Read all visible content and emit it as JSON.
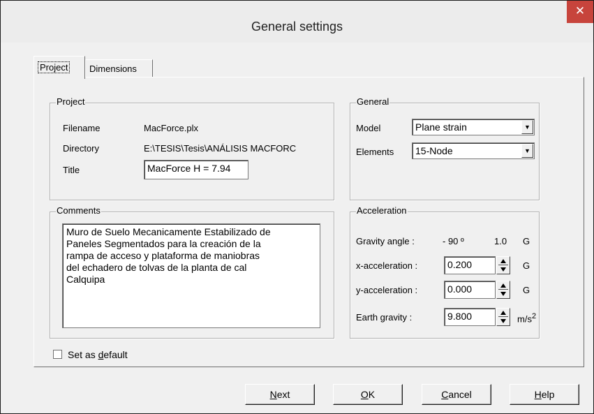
{
  "window": {
    "title": "General settings",
    "close_glyph": "✕"
  },
  "tabs": [
    {
      "label": "Project",
      "selected": true
    },
    {
      "label": "Dimensions",
      "selected": false
    }
  ],
  "project_group": {
    "title": "Project",
    "filename_label": "Filename",
    "filename_value": "MacForce.plx",
    "directory_label": "Directory",
    "directory_value": "E:\\TESIS\\Tesis\\ANÁLISIS MACFORC",
    "title_label": "Title",
    "title_value": "MacForce H = 7.94"
  },
  "general_group": {
    "title": "General",
    "model_label": "Model",
    "model_value": "Plane strain",
    "elements_label": "Elements",
    "elements_value": "15-Node"
  },
  "comments_group": {
    "title": "Comments",
    "text": "Muro de Suelo Mecanicamente Estabilizado de\nPaneles Segmentados para la creación de la\nrampa de acceso y plataforma de maniobras\ndel echadero de tolvas de la planta de cal\nCalquipa"
  },
  "acceleration_group": {
    "title": "Acceleration",
    "gravity_angle_label": "Gravity angle :",
    "gravity_angle_value": "- 90 º",
    "gravity_g_value": "1.0",
    "g_unit": "G",
    "x_label": "x-acceleration :",
    "x_value": "0.200",
    "y_label": "y-acceleration :",
    "y_value": "0.000",
    "earth_label": "Earth gravity :",
    "earth_value": "9.800",
    "earth_unit": "m/s",
    "earth_unit_sup": "2"
  },
  "default_checkbox": {
    "label_pre": "Set as ",
    "label_accel": "d",
    "label_post": "efault",
    "checked": false
  },
  "buttons": {
    "next": {
      "accel": "N",
      "rest": "ext"
    },
    "ok": {
      "accel": "O",
      "rest": "K"
    },
    "cancel": {
      "accel": "C",
      "rest": "ancel"
    },
    "help": {
      "accel": "H",
      "rest": "elp"
    }
  }
}
